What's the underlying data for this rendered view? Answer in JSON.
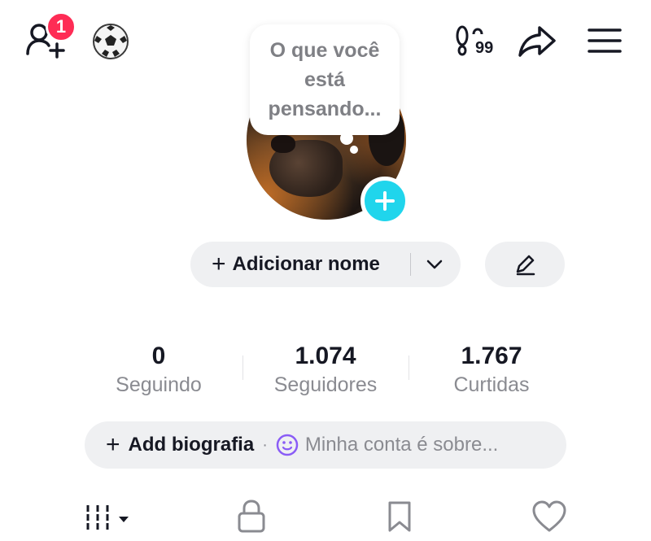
{
  "header": {
    "notification_count": "1",
    "footprint_count": "99",
    "icons": {
      "add_friends": "add-friend-icon",
      "soccer": "soccer-ball-icon",
      "footprint": "footprint-icon",
      "share": "share-icon",
      "menu": "hamburger-menu-icon"
    }
  },
  "profile": {
    "thought_bubble": "O que você está pensando...",
    "name_button": "Adicionar nome",
    "name_plus": "+"
  },
  "stats": [
    {
      "value": "0",
      "label": "Seguindo"
    },
    {
      "value": "1.074",
      "label": "Seguidores"
    },
    {
      "value": "1.767",
      "label": "Curtidas"
    }
  ],
  "bio": {
    "plus": "+",
    "add_label": "Add biografia",
    "separator": "·",
    "placeholder": "Minha conta é sobre..."
  },
  "tabs": [
    {
      "icon": "videos-grid-icon"
    },
    {
      "icon": "lock-icon"
    },
    {
      "icon": "bookmark-icon"
    },
    {
      "icon": "heart-icon"
    }
  ],
  "colors": {
    "badge_red": "#fe2c55",
    "accent_cyan": "#20d5ec",
    "pill_gray": "#eff0f2",
    "secondary_text": "#8a8b91",
    "emoji_purple": "#8a5cf6"
  }
}
